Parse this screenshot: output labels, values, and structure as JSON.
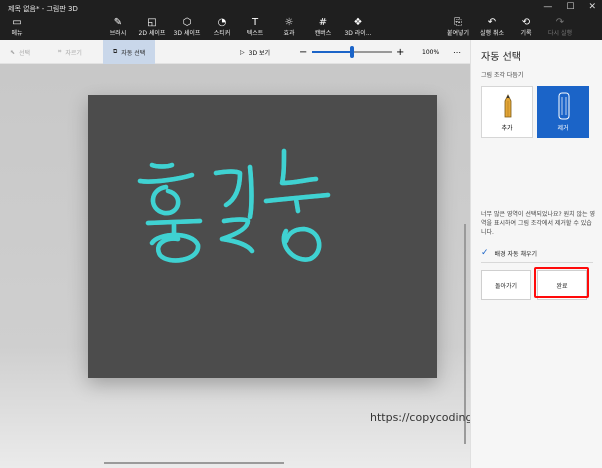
{
  "window": {
    "title": "제목 없음* - 그림판 3D",
    "minimize": "—",
    "maximize": "☐",
    "close": "✕"
  },
  "toolbar": {
    "menu": "메뉴",
    "brushes": "브러시",
    "shapes2d": "2D 셰이프",
    "shapes3d": "3D 셰이프",
    "stickers": "스티커",
    "text": "텍스트",
    "effects": "효과",
    "canvas": "캔버스",
    "library3d": "3D 라이...",
    "paste": "붙여넣기",
    "undo": "실행 취소",
    "history": "기록",
    "redo": "다시 실행"
  },
  "subbar": {
    "select": "선택",
    "crop": "자르기",
    "magic_select": "자동 선택",
    "view3d": "3D 보기",
    "zoom": "100%",
    "zoom_level": 0.5
  },
  "panel": {
    "title": "자동 선택",
    "subtitle": "그림 조각 다듬기",
    "add": "추가",
    "remove": "제거",
    "message": "너무 많은 영역이 선택되었나요? 원치 않는 영역을 표시하여 그림 조각에서 제거할 수 있습니다.",
    "autofill": "배경 자동 채우기",
    "back": "돌아가기",
    "done": "완료"
  },
  "watermark": "https://copycoding.tistory.com/",
  "colors": {
    "accent": "#1b64c8",
    "highlight_frame": "#ff0a0a",
    "canvas": "#4c4c4c",
    "stroke": "#1f3c3c",
    "stroke_glow": "#3fd6d6"
  }
}
